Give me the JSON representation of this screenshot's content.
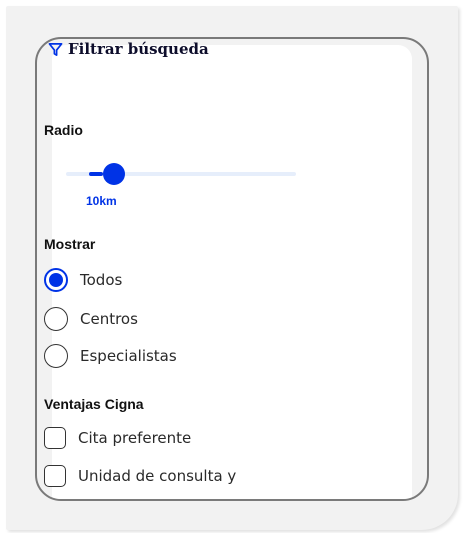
{
  "filter": {
    "title": "Filtrar búsqueda",
    "icon": "filter-icon"
  },
  "radius": {
    "label": "Radio",
    "value_label": "10km",
    "value_km": 10,
    "fraction": 0.12
  },
  "show": {
    "label": "Mostrar",
    "options": [
      {
        "label": "Todos",
        "selected": true
      },
      {
        "label": "Centros",
        "selected": false
      },
      {
        "label": "Especialistas",
        "selected": false
      }
    ]
  },
  "advantages": {
    "label": "Ventajas Cigna",
    "options": [
      {
        "label": "Cita preferente",
        "checked": false
      },
      {
        "label": "Unidad de consulta y",
        "checked": false
      }
    ]
  },
  "colors": {
    "accent": "#0033e6",
    "track": "#e6eefb",
    "text": "#111111"
  }
}
